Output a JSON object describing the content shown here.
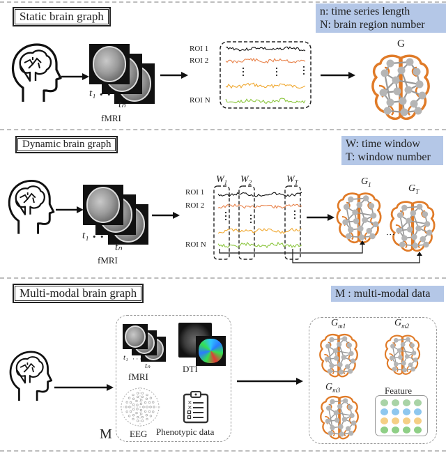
{
  "sections": {
    "static": {
      "title": "Static brain graph",
      "legend": "n: time series length\nN: brain region number",
      "roi_labels": [
        "ROI 1",
        "ROI 2",
        "ROI N"
      ],
      "fmri_label": "fMRI",
      "t_start": "t₁",
      "t_end": "tₙ",
      "graph_label": "G"
    },
    "dynamic": {
      "title": "Dynamic brain graph",
      "legend": "W: time window\nT: window number",
      "roi_labels": [
        "ROI 1",
        "ROI 2",
        "ROI N"
      ],
      "fmri_label": "fMRI",
      "t_start": "t₁",
      "t_end": "tₙ",
      "windows": [
        "W₁",
        "W₂",
        "Wₜ"
      ],
      "window_labels": {
        "w1": "W",
        "w1_sub": "1",
        "w2": "W",
        "w2_sub": "2",
        "wt": "W",
        "wt_sub": "T"
      },
      "graph_labels": {
        "g1": "G",
        "g1_sub": "1",
        "gt": "G",
        "gt_sub": "T"
      }
    },
    "multimodal": {
      "title": "Multi-modal brain graph",
      "legend": "M : multi-modal data",
      "m_label": "M",
      "modalities": [
        "fMRI",
        "DTI",
        "EEG",
        "Phenotypic data"
      ],
      "t_start": "t₁",
      "t_end": "tₙ",
      "graph_labels": [
        {
          "base": "G",
          "sub": "m1"
        },
        {
          "base": "G",
          "sub": "m2"
        },
        {
          "base": "G",
          "sub": "m3"
        }
      ],
      "feature_label": "Feature",
      "feature_colors": [
        "#a9d3a6",
        "#8ec7ee",
        "#f5cf85",
        "#8fcf86"
      ]
    }
  },
  "colors": {
    "brain_outline": "#e07b28",
    "graph_node": "#b5b5b5",
    "legend_bg": "#b4c7e7",
    "roi1": "#111111",
    "roi2": "#e8824a",
    "roi3": "#f0a830",
    "roiN": "#8cc63f"
  }
}
